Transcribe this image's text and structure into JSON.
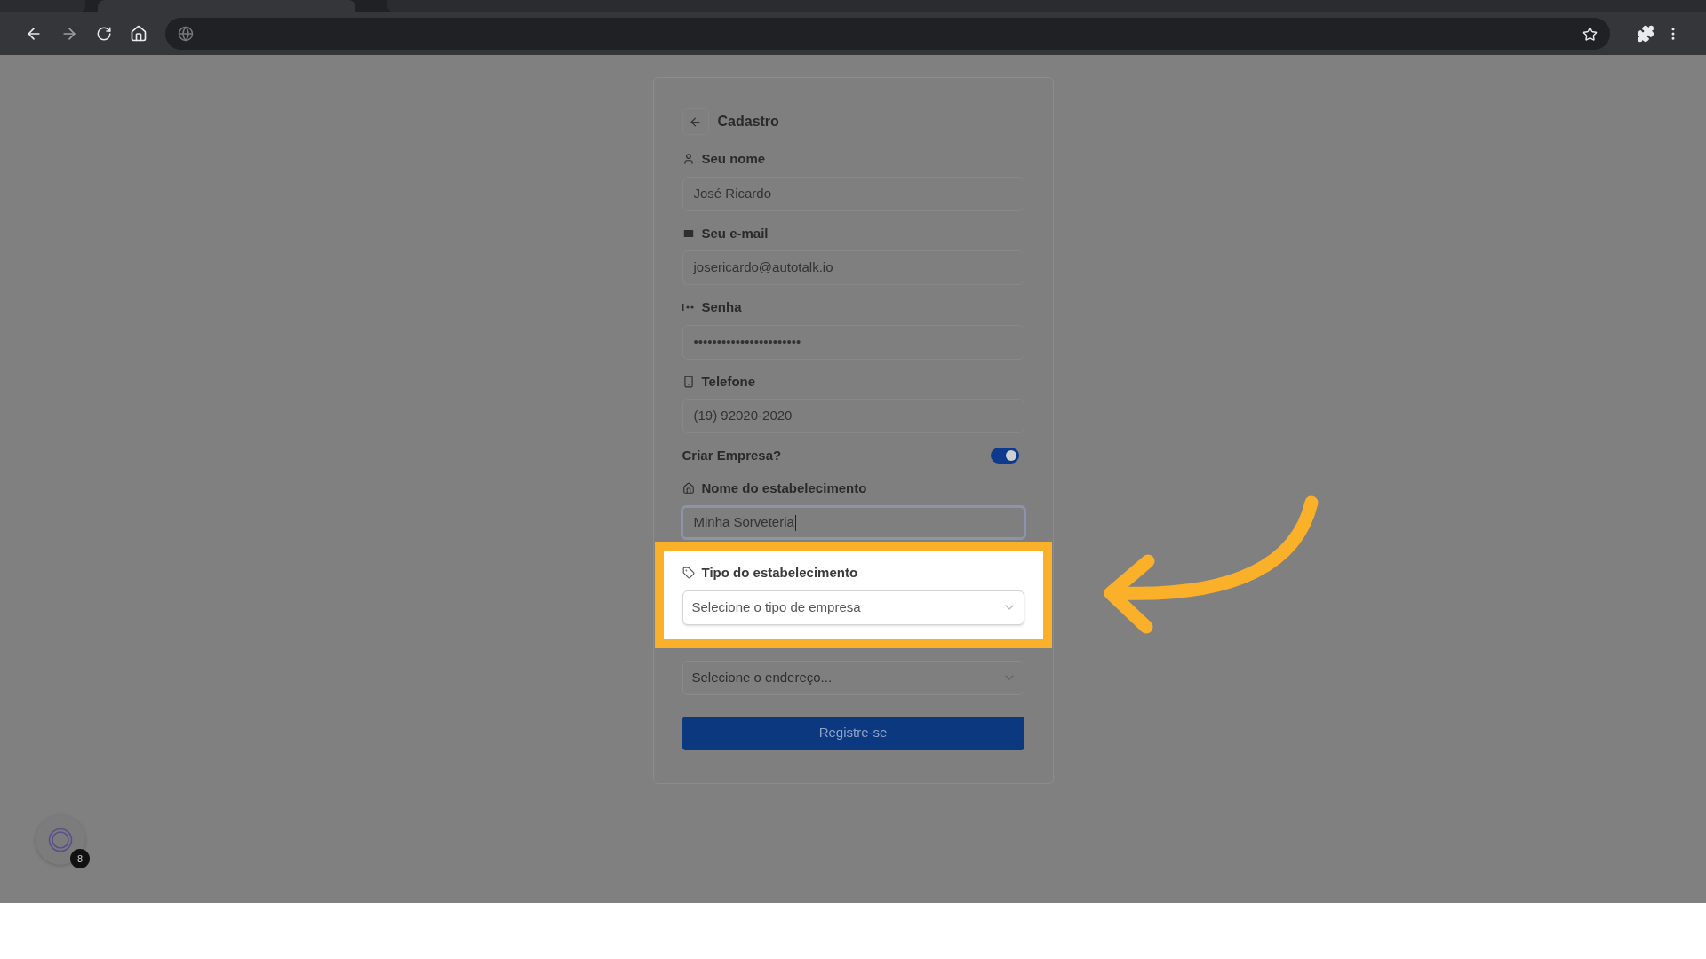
{
  "form": {
    "title": "Cadastro",
    "fields": [
      {
        "kind": "name",
        "label": "Seu nome",
        "value": "José Ricardo"
      },
      {
        "kind": "email",
        "label": "Seu e-mail",
        "value": "josericardo@autotalk.io"
      },
      {
        "kind": "password",
        "label": "Senha",
        "value": "•••••••••••••••••••••••"
      },
      {
        "kind": "phone",
        "label": "Telefone",
        "value": "(19) 92020-2020"
      },
      {
        "kind": "toggle",
        "label": "Criar Empresa?",
        "on": true
      },
      {
        "kind": "business_name",
        "label": "Nome do estabelecimento",
        "value": "Minha Sorveteria",
        "focused": true
      },
      {
        "kind": "business_type",
        "label": "Tipo do estabelecimento",
        "placeholder": "Selecione o tipo de empresa",
        "highlighted": true
      },
      {
        "kind": "location",
        "placeholder": "Selecione o endereço...",
        "highlighted": false
      }
    ],
    "submit": "Registre-se"
  },
  "chat_widget": {
    "badge": "8"
  }
}
